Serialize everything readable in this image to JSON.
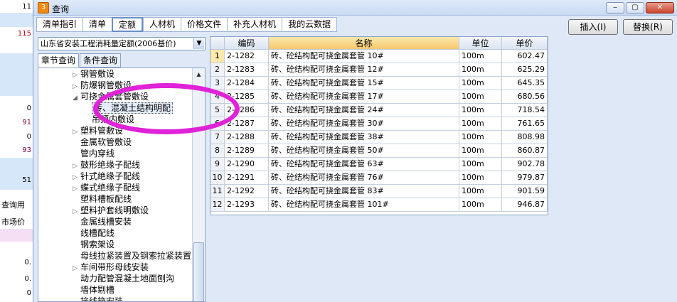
{
  "background_app": {
    "cells": [
      {
        "text": "11",
        "style": ""
      },
      {
        "text": "115",
        "style": "red"
      },
      {
        "text": "0",
        "style": ""
      },
      {
        "text": "91",
        "style": "purple"
      },
      {
        "text": "0",
        "style": ""
      },
      {
        "text": "93",
        "style": "purple"
      },
      {
        "text": "51",
        "style": ""
      }
    ],
    "label_query": "查询用",
    "label_market": "市场价",
    "cells_bottom": [
      "0.",
      "0.",
      "0",
      "0"
    ]
  },
  "window": {
    "title": "查询",
    "icon_letter": "3",
    "minimize": "‒",
    "maximize": "▢",
    "close": "✕"
  },
  "tabs": [
    "清单指引",
    "清单",
    "定额",
    "人材机",
    "价格文件",
    "补充人材机",
    "我的云数据"
  ],
  "active_tab": "定额",
  "buttons": {
    "insert": "插入(I)",
    "replace": "替换(R)"
  },
  "left": {
    "dept_select": "山东省安装工程消耗量定额(2006基价)",
    "subtabs": [
      "章节查询",
      "条件查询"
    ],
    "tree": [
      {
        "label": "钢管敷设",
        "expander": "▷",
        "indent": 1
      },
      {
        "label": "防爆钢管敷设",
        "expander": "▷",
        "indent": 1
      },
      {
        "label": "可挠金属套管敷设",
        "expander": "◢",
        "indent": 1
      },
      {
        "label": "砖、混凝土结构明配",
        "expander": "",
        "indent": 2,
        "selected": true
      },
      {
        "label": "吊顶内敷设",
        "expander": "",
        "indent": 2
      },
      {
        "label": "塑料管敷设",
        "expander": "▷",
        "indent": 1
      },
      {
        "label": "金属软管敷设",
        "expander": "",
        "indent": 1
      },
      {
        "label": "管内穿线",
        "expander": "",
        "indent": 1
      },
      {
        "label": "鼓形绝缘子配线",
        "expander": "▷",
        "indent": 1
      },
      {
        "label": "针式绝缘子配线",
        "expander": "▷",
        "indent": 1
      },
      {
        "label": "蝶式绝缘子配线",
        "expander": "▷",
        "indent": 1
      },
      {
        "label": "塑料槽板配线",
        "expander": "",
        "indent": 1
      },
      {
        "label": "塑料护套线明敷设",
        "expander": "▷",
        "indent": 1
      },
      {
        "label": "金属线槽安装",
        "expander": "",
        "indent": 1
      },
      {
        "label": "线槽配线",
        "expander": "",
        "indent": 1
      },
      {
        "label": "钢索架设",
        "expander": "",
        "indent": 1
      },
      {
        "label": "母线拉紧装置及钢索拉紧装置",
        "expander": "",
        "indent": 1
      },
      {
        "label": "车间带形母线安装",
        "expander": "▷",
        "indent": 1
      },
      {
        "label": "动力配管混凝土地面刨沟",
        "expander": "",
        "indent": 1
      },
      {
        "label": "墙体剔槽",
        "expander": "",
        "indent": 1
      },
      {
        "label": "接线箱安装",
        "expander": "",
        "indent": 1
      }
    ]
  },
  "grid": {
    "headers": [
      "",
      "编码",
      "名称",
      "单位",
      "单价"
    ],
    "rows": [
      {
        "n": "1",
        "code": "2-1282",
        "name": "砖、砼结构配可挠金属套管 10#",
        "unit": "100m",
        "price": "602.47"
      },
      {
        "n": "2",
        "code": "2-1283",
        "name": "砖、砼结构配可挠金属套管 12#",
        "unit": "100m",
        "price": "625.29"
      },
      {
        "n": "3",
        "code": "2-1284",
        "name": "砖、砼结构配可挠金属套管 15#",
        "unit": "100m",
        "price": "645.35"
      },
      {
        "n": "4",
        "code": "2-1285",
        "name": "砖、砼结构配可挠金属套管 17#",
        "unit": "100m",
        "price": "680.56"
      },
      {
        "n": "5",
        "code": "2-1286",
        "name": "砖、砼结构配可挠金属套管 24#",
        "unit": "100m",
        "price": "718.54"
      },
      {
        "n": "6",
        "code": "2-1287",
        "name": "砖、砼结构配可挠金属套管 30#",
        "unit": "100m",
        "price": "761.65"
      },
      {
        "n": "7",
        "code": "2-1288",
        "name": "砖、砼结构配可挠金属套管 38#",
        "unit": "100m",
        "price": "808.98"
      },
      {
        "n": "8",
        "code": "2-1289",
        "name": "砖、砼结构配可挠金属套管 50#",
        "unit": "100m",
        "price": "860.87"
      },
      {
        "n": "9",
        "code": "2-1290",
        "name": "砖、砼结构配可挠金属套管 63#",
        "unit": "100m",
        "price": "902.78"
      },
      {
        "n": "10",
        "code": "2-1291",
        "name": "砖、砼结构配可挠金属套管 76#",
        "unit": "100m",
        "price": "979.87"
      },
      {
        "n": "11",
        "code": "2-1292",
        "name": "砖、砼结构配可挠金属套管 83#",
        "unit": "100m",
        "price": "901.59"
      },
      {
        "n": "12",
        "code": "2-1293",
        "name": "砖、砼结构配可挠金属套管 101#",
        "unit": "100m",
        "price": "946.87"
      }
    ]
  },
  "colors": {
    "annotation": "#e022d8",
    "header_highlight": "#f6c86b"
  }
}
